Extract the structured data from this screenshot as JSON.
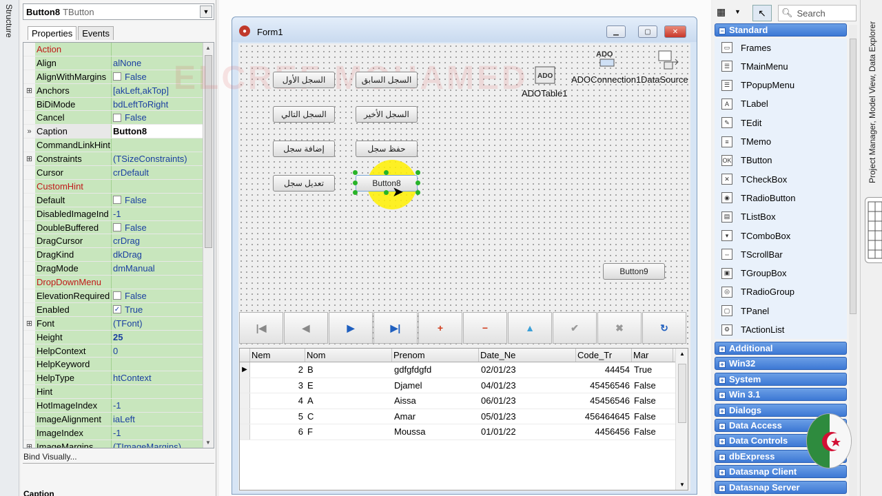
{
  "structure_tab": {
    "label": "Structure"
  },
  "inspector": {
    "object_name": "Button8",
    "object_type": "TButton",
    "tabs": [
      {
        "label": "Properties"
      },
      {
        "label": "Events"
      }
    ],
    "properties": [
      {
        "name": "Action",
        "value": "",
        "event": true
      },
      {
        "name": "Align",
        "value": "alNone"
      },
      {
        "name": "AlignWithMargins",
        "value": "False",
        "checkbox": true
      },
      {
        "name": "Anchors",
        "value": "[akLeft,akTop]",
        "expandable": true
      },
      {
        "name": "BiDiMode",
        "value": "bdLeftToRight"
      },
      {
        "name": "Cancel",
        "value": "False",
        "checkbox": true
      },
      {
        "name": "Caption",
        "value": "Button8",
        "selected": true
      },
      {
        "name": "CommandLinkHint",
        "value": ""
      },
      {
        "name": "Constraints",
        "value": "(TSizeConstraints)",
        "expandable": true
      },
      {
        "name": "Cursor",
        "value": "crDefault"
      },
      {
        "name": "CustomHint",
        "value": "",
        "event": true
      },
      {
        "name": "Default",
        "value": "False",
        "checkbox": true
      },
      {
        "name": "DisabledImageInd",
        "value": "-1"
      },
      {
        "name": "DoubleBuffered",
        "value": "False",
        "checkbox": true
      },
      {
        "name": "DragCursor",
        "value": "crDrag"
      },
      {
        "name": "DragKind",
        "value": "dkDrag"
      },
      {
        "name": "DragMode",
        "value": "dmManual"
      },
      {
        "name": "DropDownMenu",
        "value": "",
        "event": true
      },
      {
        "name": "ElevationRequired",
        "value": "False",
        "checkbox": true
      },
      {
        "name": "Enabled",
        "value": "True",
        "checkbox": true,
        "checked": true
      },
      {
        "name": "Font",
        "value": "(TFont)",
        "expandable": true
      },
      {
        "name": "Height",
        "value": "25",
        "bold": true
      },
      {
        "name": "HelpContext",
        "value": "0"
      },
      {
        "name": "HelpKeyword",
        "value": ""
      },
      {
        "name": "HelpType",
        "value": "htContext"
      },
      {
        "name": "Hint",
        "value": ""
      },
      {
        "name": "HotImageIndex",
        "value": "-1"
      },
      {
        "name": "ImageAlignment",
        "value": "iaLeft"
      },
      {
        "name": "ImageIndex",
        "value": "-1"
      },
      {
        "name": "ImageMargins",
        "value": "(TImageMargins)",
        "expandable": true
      }
    ],
    "bind_visually": "Bind Visually...",
    "footer_caption": "Caption"
  },
  "form": {
    "title": "Form1",
    "watermark": "ELCREF MOHAMED",
    "buttons": [
      {
        "label": "السجل الأول"
      },
      {
        "label": "السجل السابق"
      },
      {
        "label": "السجل التالي"
      },
      {
        "label": "السجل الأخير"
      },
      {
        "label": "إضافة سجل"
      },
      {
        "label": "حفظ سجل"
      },
      {
        "label": "تعديل سجل"
      },
      {
        "label": "Button8"
      },
      {
        "label": "Button9"
      }
    ],
    "components": [
      {
        "name": "ADOTable1",
        "icon": "ado-table-icon"
      },
      {
        "name": "ADOConnection1",
        "icon": "ado-connection-icon"
      },
      {
        "name": "DataSource",
        "icon": "datasource-icon"
      }
    ],
    "navigator": [
      {
        "icon": "first-icon",
        "glyph": "|◀"
      },
      {
        "icon": "prior-icon",
        "glyph": "◀"
      },
      {
        "icon": "next-icon",
        "glyph": "▶"
      },
      {
        "icon": "last-icon",
        "glyph": "▶|"
      },
      {
        "icon": "insert-icon",
        "glyph": "+"
      },
      {
        "icon": "delete-icon",
        "glyph": "−"
      },
      {
        "icon": "edit-icon",
        "glyph": "▲"
      },
      {
        "icon": "post-icon",
        "glyph": "✔"
      },
      {
        "icon": "cancel-icon",
        "glyph": "✖"
      },
      {
        "icon": "refresh-icon",
        "glyph": "↻"
      }
    ],
    "grid": {
      "columns": [
        "Nem",
        "Nom",
        "Prenom",
        "Date_Ne",
        "Code_Tr",
        "Mar"
      ],
      "rows": [
        [
          "2",
          "B",
          "gdfgfdgfd",
          "02/01/23",
          "44454",
          "True"
        ],
        [
          "3",
          "E",
          "Djamel",
          "04/01/23",
          "45456546",
          "False"
        ],
        [
          "4",
          "A",
          "Aissa",
          "06/01/23",
          "45456546",
          "False"
        ],
        [
          "5",
          "C",
          "Amar",
          "05/01/23",
          "456464645",
          "False"
        ],
        [
          "6",
          "F",
          "Moussa",
          "01/01/22",
          "4456456",
          "False"
        ]
      ]
    }
  },
  "palette": {
    "search_placeholder": "Search",
    "standard_label": "Standard",
    "standard_items": [
      {
        "label": "Frames",
        "icon": "frames-icon"
      },
      {
        "label": "TMainMenu",
        "icon": "mainmenu-icon"
      },
      {
        "label": "TPopupMenu",
        "icon": "popupmenu-icon"
      },
      {
        "label": "TLabel",
        "icon": "label-icon"
      },
      {
        "label": "TEdit",
        "icon": "edit-icon"
      },
      {
        "label": "TMemo",
        "icon": "memo-icon"
      },
      {
        "label": "TButton",
        "icon": "button-icon"
      },
      {
        "label": "TCheckBox",
        "icon": "checkbox-icon"
      },
      {
        "label": "TRadioButton",
        "icon": "radiobutton-icon"
      },
      {
        "label": "TListBox",
        "icon": "listbox-icon"
      },
      {
        "label": "TComboBox",
        "icon": "combobox-icon"
      },
      {
        "label": "TScrollBar",
        "icon": "scrollbar-icon"
      },
      {
        "label": "TGroupBox",
        "icon": "groupbox-icon"
      },
      {
        "label": "TRadioGroup",
        "icon": "radiogroup-icon"
      },
      {
        "label": "TPanel",
        "icon": "panel-icon"
      },
      {
        "label": "TActionList",
        "icon": "actionlist-icon"
      }
    ],
    "categories": [
      {
        "label": "Additional"
      },
      {
        "label": "Win32"
      },
      {
        "label": "System"
      },
      {
        "label": "Win 3.1"
      },
      {
        "label": "Dialogs"
      },
      {
        "label": "Data Access"
      },
      {
        "label": "Data Controls"
      },
      {
        "label": "dbExpress"
      },
      {
        "label": "Datasnap Client"
      },
      {
        "label": "Datasnap Server"
      }
    ]
  },
  "right_dock": {
    "label": "Project Manager, Model View, Data Explorer"
  }
}
